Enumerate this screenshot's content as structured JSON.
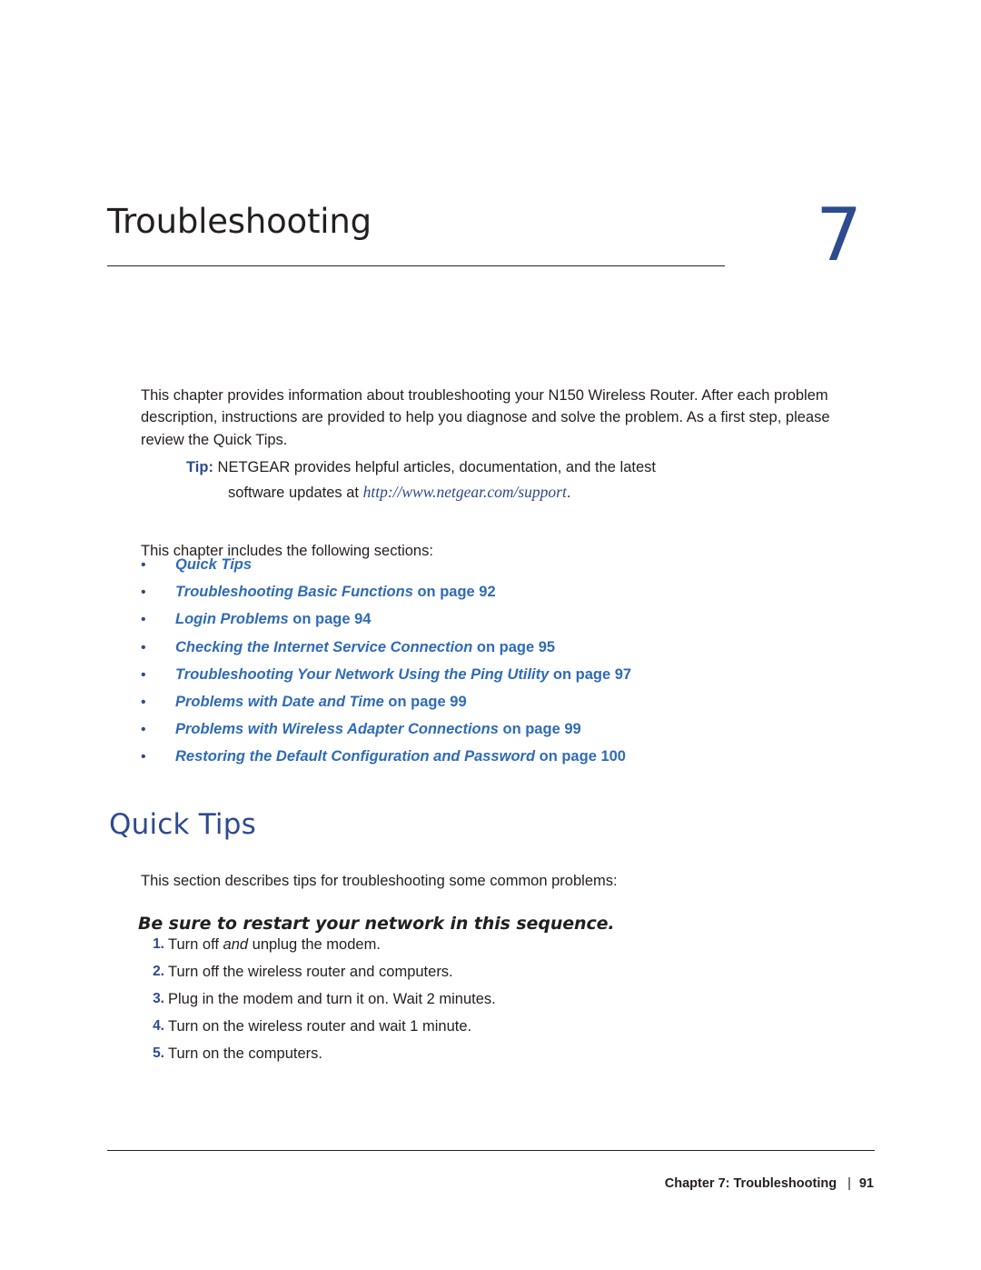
{
  "chapter": {
    "title": "Troubleshooting",
    "number": "7"
  },
  "intro": "This chapter provides information about troubleshooting your N150 Wireless Router. After each problem description, instructions are provided to help you diagnose and solve the problem. As a first step, please review the Quick Tips.",
  "tip": {
    "label": "Tip:",
    "text": "NETGEAR provides helpful articles, documentation, and the latest",
    "line2_prefix": "software updates at ",
    "url": "http://www.netgear.com/support",
    "line2_suffix": "."
  },
  "includes_line": "This chapter includes the following sections:",
  "sections": [
    {
      "link": "Quick Tips",
      "tail": ""
    },
    {
      "link": "Troubleshooting Basic Functions",
      "tail": " on page 92"
    },
    {
      "link": "Login Problems",
      "tail": " on page 94"
    },
    {
      "link": "Checking the Internet Service Connection",
      "tail": " on page 95"
    },
    {
      "link": "Troubleshooting Your Network Using the Ping Utility",
      "tail": " on page 97"
    },
    {
      "link": "Problems with Date and Time",
      "tail": " on page 99"
    },
    {
      "link": "Problems with Wireless Adapter Connections",
      "tail": " on page 99"
    },
    {
      "link": "Restoring the Default Configuration and Password",
      "tail": " on page 100"
    }
  ],
  "quick_tips": {
    "heading": "Quick Tips",
    "intro": "This section describes tips for troubleshooting some common problems:",
    "subheading": "Be sure to restart your network in this sequence.",
    "steps": [
      {
        "num": "1.",
        "pre": "Turn off ",
        "em": "and",
        "post": " unplug the modem."
      },
      {
        "num": "2.",
        "pre": "Turn off the wireless router and computers.",
        "em": "",
        "post": ""
      },
      {
        "num": "3.",
        "pre": "Plug in the modem and turn it on. Wait 2 minutes.",
        "em": "",
        "post": ""
      },
      {
        "num": "4.",
        "pre": "Turn on the wireless router and wait 1 minute.",
        "em": "",
        "post": ""
      },
      {
        "num": "5.",
        "pre": "Turn on the computers.",
        "em": "",
        "post": ""
      }
    ]
  },
  "footer": {
    "text": "Chapter 7:  Troubleshooting",
    "separator": "|",
    "page": "91"
  },
  "colors": {
    "accent_blue": "#2d4b8e",
    "link_blue": "#2f6bb5",
    "body_black": "#231f20"
  }
}
